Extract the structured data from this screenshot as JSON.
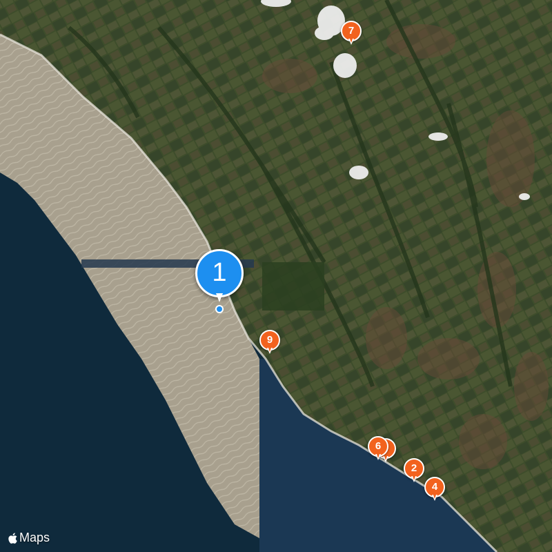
{
  "map": {
    "style": "satellite",
    "colors": {
      "land": "#3f4f2a",
      "ocean_deep": "#0f2a3c",
      "surf": "#a59c88",
      "accent_pin": "#f2621e",
      "selected_pin": "#1d8ff0"
    }
  },
  "markers": [
    {
      "label": "1",
      "selected": true
    },
    {
      "label": "2"
    },
    {
      "label": "4"
    },
    {
      "label": "6"
    },
    {
      "label": "7"
    },
    {
      "label": "9"
    }
  ],
  "attribution": {
    "text": "Maps",
    "icon": "apple-logo-icon"
  }
}
